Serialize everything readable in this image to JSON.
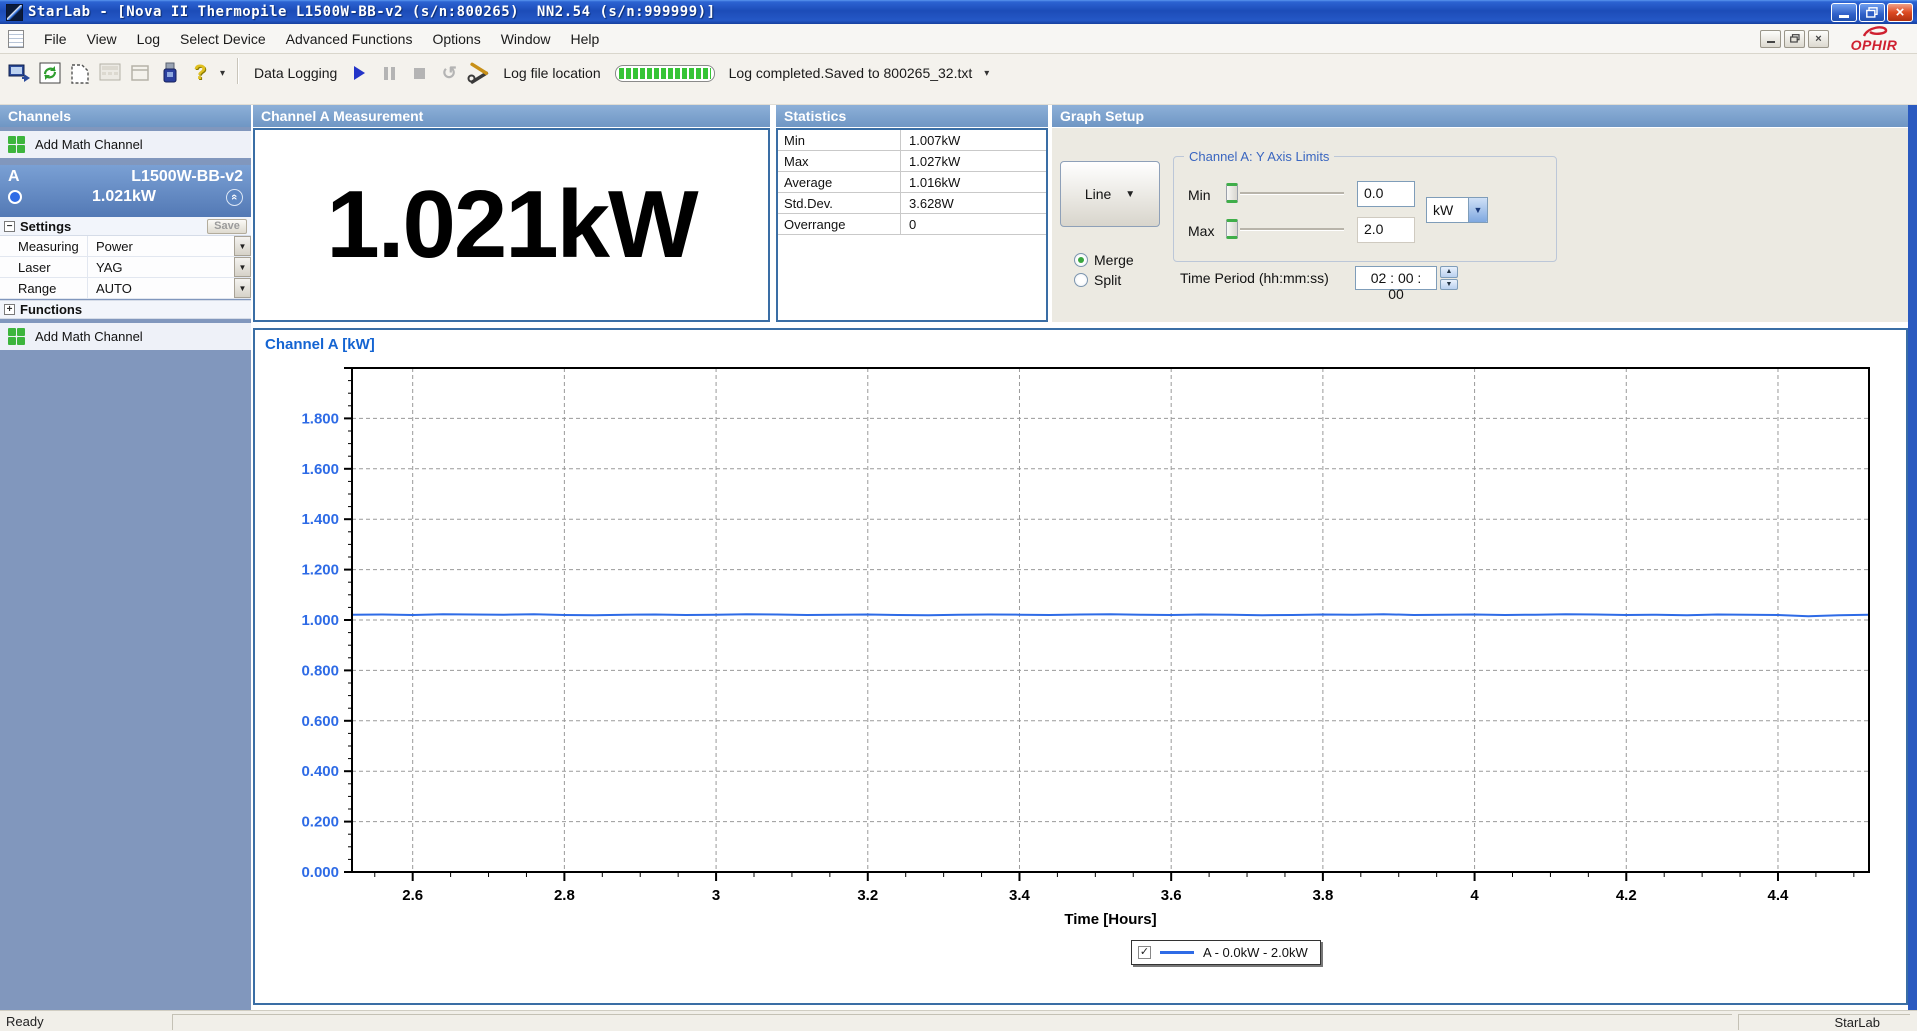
{
  "window": {
    "title": "StarLab - [Nova II Thermopile L1500W-BB-v2 (s/n:800265)  NN2.54 (s/n:999999)]",
    "status_left": "Ready",
    "status_right": "StarLab"
  },
  "menu": {
    "items": [
      "File",
      "View",
      "Log",
      "Select Device",
      "Advanced Functions",
      "Options",
      "Window",
      "Help"
    ]
  },
  "toolbar": {
    "data_logging_label": "Data Logging",
    "log_file_location_label": "Log file location",
    "log_status": "Log completed.Saved to 800265_32.txt",
    "progress_percent": 100
  },
  "sidebar": {
    "header": "Channels",
    "add_math_channel": "Add Math Channel",
    "channel": {
      "id": "A",
      "device": "L1500W-BB-v2",
      "value": "1.021kW"
    },
    "settings": {
      "header": "Settings",
      "save_label": "Save",
      "rows": [
        {
          "label": "Measuring",
          "value": "Power"
        },
        {
          "label": "Laser",
          "value": "YAG"
        },
        {
          "label": "Range",
          "value": "AUTO"
        }
      ]
    },
    "functions_header": "Functions",
    "add_math_channel_2": "Add Math Channel"
  },
  "measurement_panel": {
    "header": "Channel A Measurement",
    "value": "1.021kW"
  },
  "statistics": {
    "header": "Statistics",
    "rows": [
      {
        "label": "Min",
        "value": "1.007kW"
      },
      {
        "label": "Max",
        "value": "1.027kW"
      },
      {
        "label": "Average",
        "value": "1.016kW"
      },
      {
        "label": "Std.Dev.",
        "value": "3.628W"
      },
      {
        "label": "Overrange",
        "value": "0"
      }
    ]
  },
  "graph_setup": {
    "header": "Graph Setup",
    "line_type": "Line",
    "y_axis_group": "Channel A: Y Axis Limits",
    "min_label": "Min",
    "max_label": "Max",
    "min_value": "0.0",
    "max_value": "2.0",
    "unit": "kW",
    "merge_label": "Merge",
    "split_label": "Split",
    "merge_selected": true,
    "time_period_label": "Time Period (hh:mm:ss)",
    "time_period_value": "02 : 00 : 00"
  },
  "chart_data": {
    "type": "line",
    "title": "Channel A [kW]",
    "xlabel": "Time [Hours]",
    "xlim": [
      2.52,
      4.52
    ],
    "ylim": [
      0,
      2.0
    ],
    "grid": true,
    "line_color": "#2e6be6",
    "x_ticks": [
      {
        "v": 2.6,
        "label": "2.6"
      },
      {
        "v": 2.8,
        "label": "2.8"
      },
      {
        "v": 3.0,
        "label": "3"
      },
      {
        "v": 3.2,
        "label": "3.2"
      },
      {
        "v": 3.4,
        "label": "3.4"
      },
      {
        "v": 3.6,
        "label": "3.6"
      },
      {
        "v": 3.8,
        "label": "3.8"
      },
      {
        "v": 4.0,
        "label": "4"
      },
      {
        "v": 4.2,
        "label": "4.2"
      },
      {
        "v": 4.4,
        "label": "4.4"
      }
    ],
    "y_ticks": [
      {
        "v": 0.0,
        "label": "0.000"
      },
      {
        "v": 0.2,
        "label": "0.200"
      },
      {
        "v": 0.4,
        "label": "0.400"
      },
      {
        "v": 0.6,
        "label": "0.600"
      },
      {
        "v": 0.8,
        "label": "0.800"
      },
      {
        "v": 1.0,
        "label": "1.000"
      },
      {
        "v": 1.2,
        "label": "1.200"
      },
      {
        "v": 1.4,
        "label": "1.400"
      },
      {
        "v": 1.6,
        "label": "1.600"
      },
      {
        "v": 1.8,
        "label": "1.800"
      }
    ],
    "legend": {
      "label": "A - 0.0kW - 2.0kW",
      "checked": true,
      "position": "bottom-center"
    },
    "series": [
      {
        "name": "A",
        "color": "#2e6be6",
        "x": [
          2.52,
          2.56,
          2.6,
          2.64,
          2.68,
          2.72,
          2.76,
          2.8,
          2.84,
          2.88,
          2.92,
          2.96,
          3,
          3.04,
          3.08,
          3.12,
          3.16,
          3.2,
          3.24,
          3.28,
          3.32,
          3.36,
          3.4,
          3.44,
          3.48,
          3.52,
          3.56,
          3.6,
          3.64,
          3.68,
          3.72,
          3.76,
          3.8,
          3.84,
          3.88,
          3.92,
          3.96,
          4,
          4.04,
          4.08,
          4.12,
          4.16,
          4.2,
          4.24,
          4.28,
          4.32,
          4.36,
          4.4,
          4.44,
          4.48,
          4.52
        ],
        "y": [
          1.021,
          1.022,
          1.02,
          1.023,
          1.022,
          1.021,
          1.023,
          1.02,
          1.019,
          1.021,
          1.022,
          1.02,
          1.021,
          1.023,
          1.022,
          1.02,
          1.021,
          1.022,
          1.02,
          1.019,
          1.021,
          1.022,
          1.021,
          1.02,
          1.022,
          1.023,
          1.021,
          1.02,
          1.022,
          1.021,
          1.019,
          1.02,
          1.022,
          1.021,
          1.023,
          1.02,
          1.021,
          1.022,
          1.02,
          1.021,
          1.023,
          1.022,
          1.02,
          1.021,
          1.019,
          1.022,
          1.021,
          1.02,
          1.015,
          1.019,
          1.021
        ]
      }
    ]
  }
}
